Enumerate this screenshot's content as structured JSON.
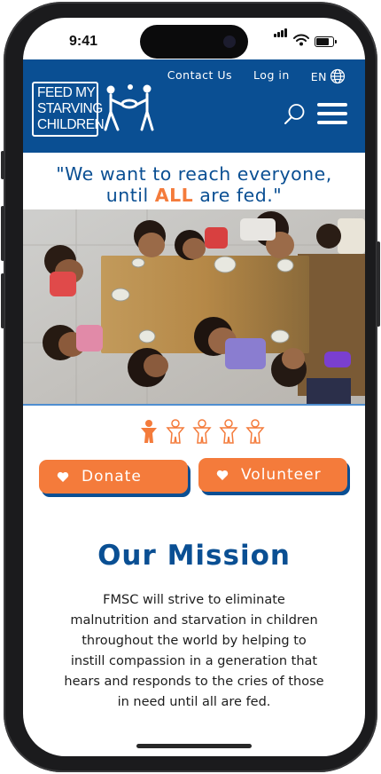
{
  "status_bar": {
    "time": "9:41",
    "signal_icon": "cellular-signal-icon",
    "wifi_icon": "wifi-icon",
    "battery_icon": "battery-icon",
    "battery_level": 0.8
  },
  "header": {
    "logo_lines": [
      "FEED MY",
      "STARVING",
      "CHILDREN"
    ],
    "links": {
      "contact": "Contact Us",
      "login": "Log in",
      "language": "EN"
    },
    "language_icon": "globe-icon",
    "search_icon": "search-icon",
    "menu_icon": "hamburger-menu-icon"
  },
  "hero": {
    "quote_part1": "\"We want to reach everyone,",
    "quote_part2_before": "until ",
    "quote_emphasis": "ALL",
    "quote_part2_after": " are fed.\"",
    "slide_count": 5,
    "active_slide": 1
  },
  "actions": {
    "donate_label": "Donate",
    "volunteer_label": "Volunteer",
    "button_icon": "heart-icon"
  },
  "mission": {
    "title": "Our Mission",
    "text": "FMSC will strive to eliminate malnutrition and starvation in children throughout the world by helping to instill compassion in a generation that hears and responds to the cries of those in need until all are fed."
  },
  "colors": {
    "brand_blue": "#0a4f93",
    "accent_orange": "#f47b3b"
  }
}
